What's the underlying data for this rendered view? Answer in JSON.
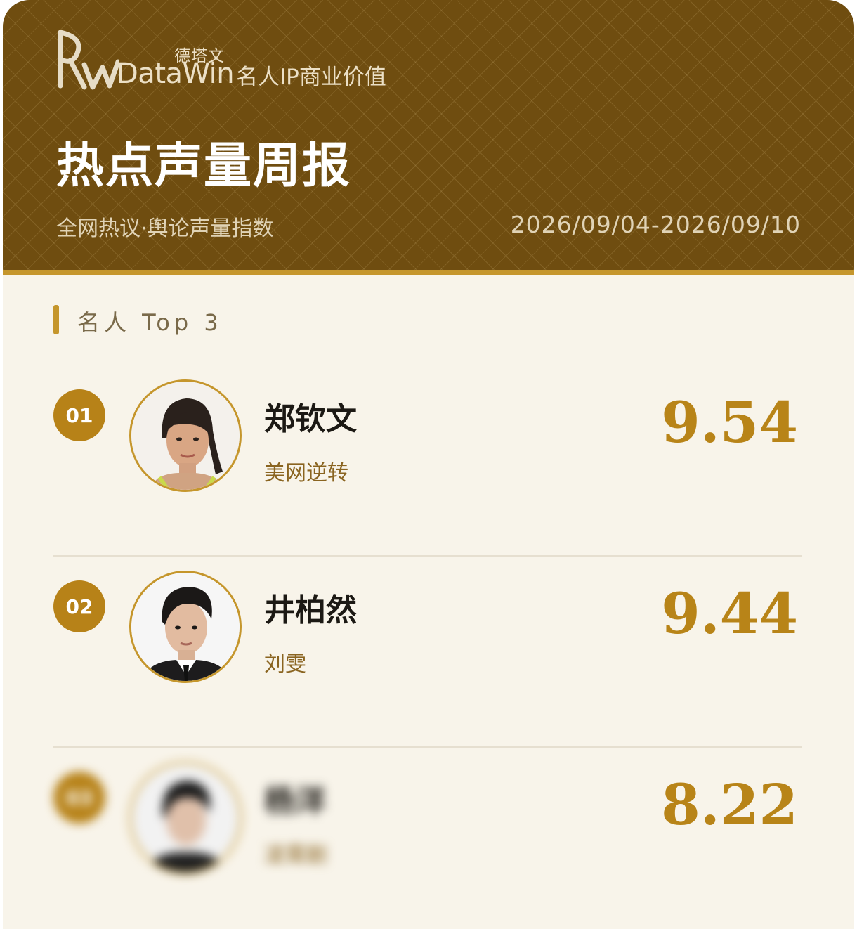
{
  "brand": {
    "name_cn": "德塔文",
    "name_en": "DataWin",
    "tagline": "名人IP商业价值"
  },
  "report": {
    "title": "热点声量周报",
    "subtitle": "全网热议·舆论声量指数",
    "date_range": "2026/09/04-2026/09/10"
  },
  "section": {
    "title": "名人 Top 3"
  },
  "entries": [
    {
      "rank": "01",
      "name": "郑钦文",
      "tag": "美网逆转",
      "score": "9.54"
    },
    {
      "rank": "02",
      "name": "井柏然",
      "tag": "刘雯",
      "score": "9.44"
    },
    {
      "rank": "03",
      "name": "杨洋",
      "tag": "凌霄剧",
      "score": "8.22"
    }
  ],
  "colors": {
    "header_bg": "#6f4d10",
    "accent_gold": "#c5962c",
    "rank_badge": "#b78218",
    "score": "#b88418",
    "background": "#f8f4ea"
  }
}
